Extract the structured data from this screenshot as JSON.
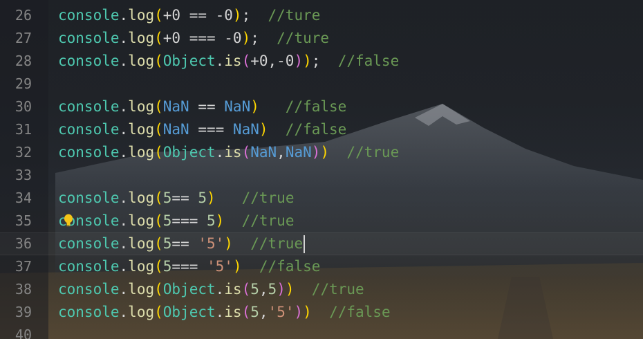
{
  "editor": {
    "lines": [
      {
        "number": "26",
        "tokens": [
          [
            "console",
            "obj"
          ],
          [
            ".",
            "punc"
          ],
          [
            "log",
            "fn"
          ],
          [
            "(",
            "paren"
          ],
          [
            "+0 == -0",
            "op"
          ],
          [
            ")",
            "paren"
          ],
          [
            ";",
            "punc"
          ],
          [
            "  //ture",
            "cmt"
          ]
        ]
      },
      {
        "number": "27",
        "tokens": [
          [
            "console",
            "obj"
          ],
          [
            ".",
            "punc"
          ],
          [
            "log",
            "fn"
          ],
          [
            "(",
            "paren"
          ],
          [
            "+0 === -0",
            "op"
          ],
          [
            ")",
            "paren"
          ],
          [
            ";",
            "punc"
          ],
          [
            "  //ture",
            "cmt"
          ]
        ]
      },
      {
        "number": "28",
        "tokens": [
          [
            "console",
            "obj"
          ],
          [
            ".",
            "punc"
          ],
          [
            "log",
            "fn"
          ],
          [
            "(",
            "paren"
          ],
          [
            "Object",
            "obj"
          ],
          [
            ".",
            "punc"
          ],
          [
            "is",
            "fn"
          ],
          [
            "(",
            "paren2"
          ],
          [
            "+0,-0",
            "op"
          ],
          [
            ")",
            "paren2"
          ],
          [
            ")",
            "paren"
          ],
          [
            ";",
            "punc"
          ],
          [
            "  //false",
            "cmt"
          ]
        ]
      },
      {
        "number": "29",
        "tokens": []
      },
      {
        "number": "30",
        "tokens": [
          [
            "console",
            "obj"
          ],
          [
            ".",
            "punc"
          ],
          [
            "log",
            "fn"
          ],
          [
            "(",
            "paren"
          ],
          [
            "NaN",
            "nan"
          ],
          [
            " == ",
            "op"
          ],
          [
            "NaN",
            "nan"
          ],
          [
            ")",
            "paren"
          ],
          [
            "   //false",
            "cmt"
          ]
        ]
      },
      {
        "number": "31",
        "tokens": [
          [
            "console",
            "obj"
          ],
          [
            ".",
            "punc"
          ],
          [
            "log",
            "fn"
          ],
          [
            "(",
            "paren"
          ],
          [
            "NaN",
            "nan"
          ],
          [
            " === ",
            "op"
          ],
          [
            "NaN",
            "nan"
          ],
          [
            ")",
            "paren"
          ],
          [
            "  //false",
            "cmt"
          ]
        ]
      },
      {
        "number": "32",
        "tokens": [
          [
            "console",
            "obj"
          ],
          [
            ".",
            "punc"
          ],
          [
            "log",
            "fn"
          ],
          [
            "(",
            "paren"
          ],
          [
            "Object",
            "obj"
          ],
          [
            ".",
            "punc"
          ],
          [
            "is",
            "fn"
          ],
          [
            "(",
            "paren2"
          ],
          [
            "NaN",
            "nan"
          ],
          [
            ",",
            "punc"
          ],
          [
            "NaN",
            "nan"
          ],
          [
            ")",
            "paren2"
          ],
          [
            ")",
            "paren"
          ],
          [
            "  //true",
            "cmt"
          ]
        ]
      },
      {
        "number": "33",
        "tokens": []
      },
      {
        "number": "34",
        "tokens": [
          [
            "console",
            "obj"
          ],
          [
            ".",
            "punc"
          ],
          [
            "log",
            "fn"
          ],
          [
            "(",
            "paren"
          ],
          [
            "5",
            "num"
          ],
          [
            "== ",
            "op"
          ],
          [
            "5",
            "num"
          ],
          [
            ")",
            "paren"
          ],
          [
            "   //true",
            "cmt"
          ]
        ]
      },
      {
        "number": "35",
        "tokens": [
          [
            "console",
            "obj"
          ],
          [
            ".",
            "punc"
          ],
          [
            "log",
            "fn"
          ],
          [
            "(",
            "paren"
          ],
          [
            "5",
            "num"
          ],
          [
            "=== ",
            "op"
          ],
          [
            "5",
            "num"
          ],
          [
            ")",
            "paren"
          ],
          [
            "  //true",
            "cmt"
          ]
        ],
        "lightbulb": true
      },
      {
        "number": "36",
        "tokens": [
          [
            "console",
            "obj"
          ],
          [
            ".",
            "punc"
          ],
          [
            "log",
            "fn"
          ],
          [
            "(",
            "paren"
          ],
          [
            "5",
            "num"
          ],
          [
            "== ",
            "op"
          ],
          [
            "'5'",
            "str"
          ],
          [
            ")",
            "paren"
          ],
          [
            "  //true",
            "cmt"
          ]
        ],
        "current": true
      },
      {
        "number": "37",
        "tokens": [
          [
            "console",
            "obj"
          ],
          [
            ".",
            "punc"
          ],
          [
            "log",
            "fn"
          ],
          [
            "(",
            "paren"
          ],
          [
            "5",
            "num"
          ],
          [
            "=== ",
            "op"
          ],
          [
            "'5'",
            "str"
          ],
          [
            ")",
            "paren"
          ],
          [
            "  //false",
            "cmt"
          ]
        ]
      },
      {
        "number": "38",
        "tokens": [
          [
            "console",
            "obj"
          ],
          [
            ".",
            "punc"
          ],
          [
            "log",
            "fn"
          ],
          [
            "(",
            "paren"
          ],
          [
            "Object",
            "obj"
          ],
          [
            ".",
            "punc"
          ],
          [
            "is",
            "fn"
          ],
          [
            "(",
            "paren2"
          ],
          [
            "5",
            "num"
          ],
          [
            ",",
            "punc"
          ],
          [
            "5",
            "num"
          ],
          [
            ")",
            "paren2"
          ],
          [
            ")",
            "paren"
          ],
          [
            "  //true",
            "cmt"
          ]
        ]
      },
      {
        "number": "39",
        "tokens": [
          [
            "console",
            "obj"
          ],
          [
            ".",
            "punc"
          ],
          [
            "log",
            "fn"
          ],
          [
            "(",
            "paren"
          ],
          [
            "Object",
            "obj"
          ],
          [
            ".",
            "punc"
          ],
          [
            "is",
            "fn"
          ],
          [
            "(",
            "paren2"
          ],
          [
            "5",
            "num"
          ],
          [
            ",",
            "punc"
          ],
          [
            "'5'",
            "str"
          ],
          [
            ")",
            "paren2"
          ],
          [
            ")",
            "paren"
          ],
          [
            "  //false",
            "cmt"
          ]
        ]
      },
      {
        "number": "40",
        "tokens": []
      }
    ],
    "icons": {
      "lightbulb": "lightbulb-icon"
    },
    "colors": {
      "object": "#4ec9b0",
      "function": "#dcdcaa",
      "paren": "#ffd700",
      "paren_nested": "#da70d6",
      "number": "#b5cea8",
      "nan": "#569cd6",
      "string": "#ce9178",
      "comment": "#6a9955",
      "line_number": "#858585"
    }
  }
}
